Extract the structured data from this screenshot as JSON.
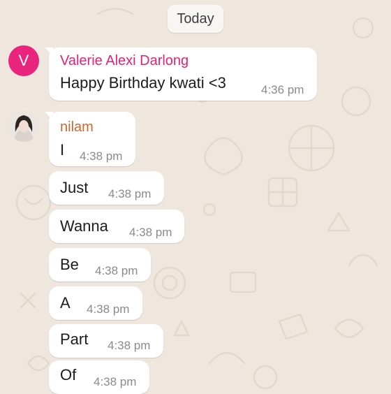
{
  "date_divider": "Today",
  "colors": {
    "background": "#efe7de",
    "valerie_name": "#e2217a",
    "nilam_name": "#d0662f",
    "avatar_v": "#e8247c"
  },
  "messages": [
    {
      "sender": "Valerie Alexi Darlong",
      "avatar_letter": "V",
      "text": "Happy Birthday kwati <3",
      "time": "4:36 pm"
    },
    {
      "sender": "nilam",
      "avatar_icon": "profile-photo",
      "lines": [
        {
          "text": "I",
          "time": "4:38 pm"
        },
        {
          "text": "Just",
          "time": "4:38 pm"
        },
        {
          "text": "Wanna",
          "time": "4:38 pm"
        },
        {
          "text": "Be",
          "time": "4:38 pm"
        },
        {
          "text": "A",
          "time": "4:38 pm"
        },
        {
          "text": "Part",
          "time": "4:38 pm"
        },
        {
          "text": "Of",
          "time": "4:38 pm"
        }
      ]
    }
  ]
}
